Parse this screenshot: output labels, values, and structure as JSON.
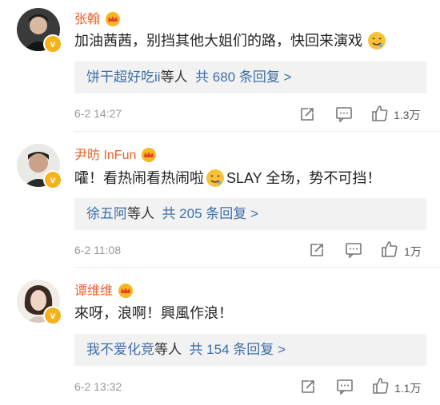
{
  "comments": [
    {
      "user": "张翰",
      "text": "加油茜茜，别挡其他大姐们的路，快回来演戏",
      "reply_users": "饼干超好吃ii",
      "reply_suffix": "等人",
      "reply_count": "共 680 条回复 >",
      "time": "6-2 14:27",
      "likes": "1.3万"
    },
    {
      "user": "尹昉 InFun",
      "text_before": "嚯！看热闹看热闹啦",
      "text_after": "SLAY 全场，势不可挡！",
      "reply_users": "徐五阿",
      "reply_suffix": "等人",
      "reply_count": "共 205 条回复 >",
      "time": "6-2 11:08",
      "likes": "1万"
    },
    {
      "user": "谭维维",
      "text": "來呀，浪啊！興風作浪！",
      "reply_users": "我不爱化竞",
      "reply_suffix": "等人",
      "reply_count": "共 154 条回复 >",
      "time": "6-2 13:32",
      "likes": "1.1万"
    }
  ],
  "colors": {
    "name": "#e8632b",
    "link": "#3d6fa8",
    "meta": "#999999",
    "verified": "#f6b21a"
  },
  "icons": [
    "verified-v-icon",
    "crown-badge-icon",
    "drool-emoji-icon",
    "share-icon",
    "comment-icon",
    "thumb-up-icon"
  ]
}
